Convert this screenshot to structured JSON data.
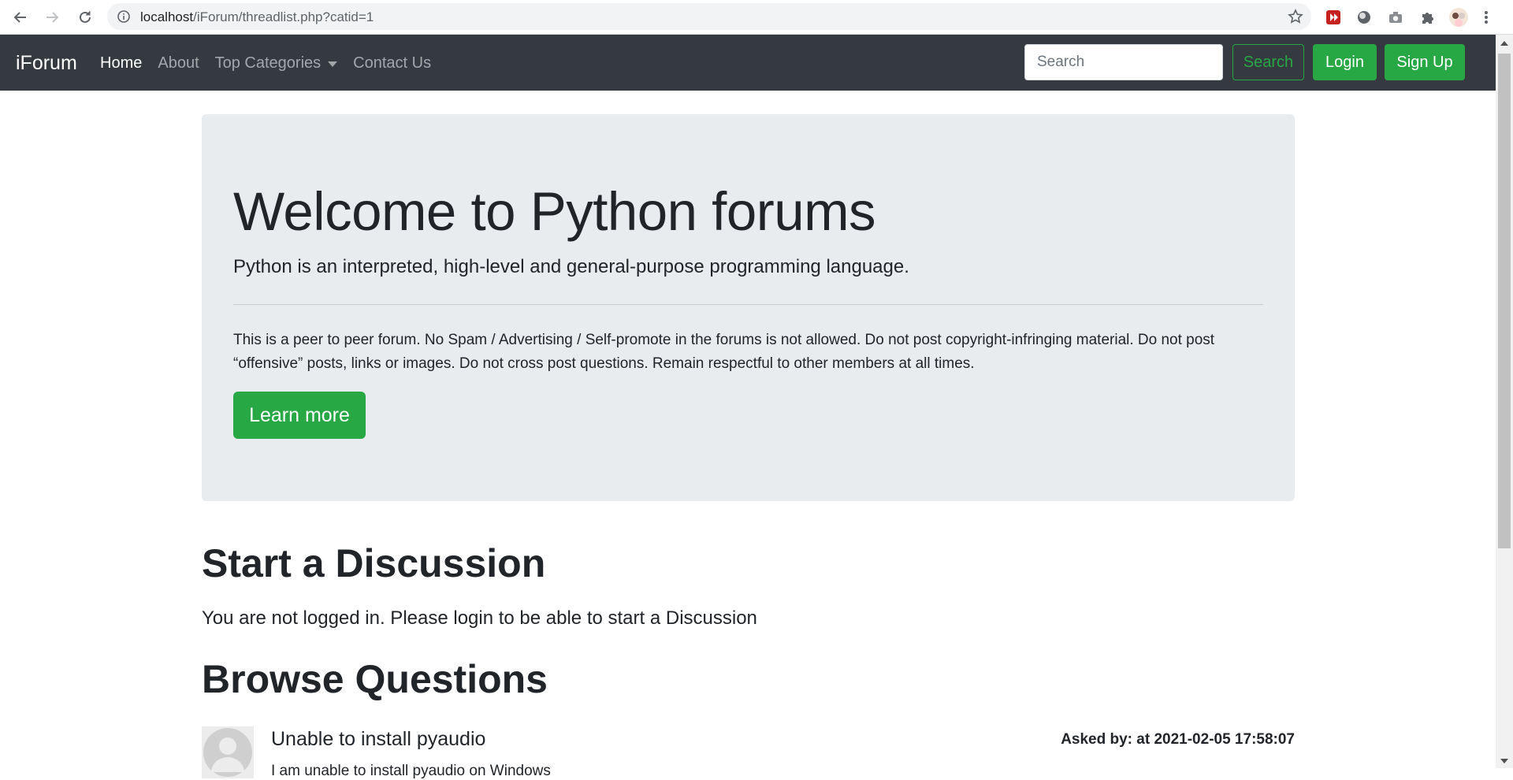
{
  "browser": {
    "url_host": "localhost",
    "url_path": "/iForum/threadlist.php?catid=1"
  },
  "navbar": {
    "brand": "iForum",
    "links": [
      {
        "label": "Home"
      },
      {
        "label": "About"
      },
      {
        "label": "Top Categories"
      },
      {
        "label": "Contact Us"
      }
    ],
    "search_placeholder": "Search",
    "search_button": "Search",
    "login_button": "Login",
    "signup_button": "Sign Up"
  },
  "jumbotron": {
    "title": "Welcome to Python forums",
    "lead": "Python is an interpreted, high-level and general-purpose programming language.",
    "rules": "This is a peer to peer forum. No Spam / Advertising / Self-promote in the forums is not allowed. Do not post copyright-infringing material. Do not post “offensive” posts, links or images. Do not cross post questions. Remain respectful to other members at all times.",
    "learn_more": "Learn more"
  },
  "discussion": {
    "heading": "Start a Discussion",
    "login_message": "You are not logged in. Please login to be able to start a Discussion"
  },
  "browse": {
    "heading": "Browse Questions",
    "questions": [
      {
        "title": "Unable to install pyaudio",
        "meta": "Asked by: at 2021-02-05 17:58:07",
        "description": "I am unable to install pyaudio on Windows"
      }
    ]
  },
  "colors": {
    "navbar_bg": "#343a40",
    "jumbotron_bg": "#e9ecef",
    "success": "#28a745"
  }
}
